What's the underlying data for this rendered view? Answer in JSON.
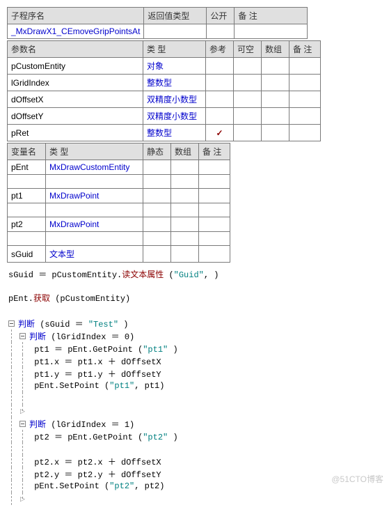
{
  "table1": {
    "headers": [
      "子程序名",
      "返回值类型",
      "公开",
      "备 注"
    ],
    "row": [
      "_MxDrawX1_CEmoveGripPointsAt",
      "",
      "",
      ""
    ]
  },
  "table2": {
    "headers": [
      "参数名",
      "类 型",
      "参考",
      "可空",
      "数组",
      "备 注"
    ],
    "rows": [
      {
        "name": "pCustomEntity",
        "type": "对象",
        "ref": "",
        "null": "",
        "arr": "",
        "note": ""
      },
      {
        "name": "lGridIndex",
        "type": "整数型",
        "ref": "",
        "null": "",
        "arr": "",
        "note": ""
      },
      {
        "name": "dOffsetX",
        "type": "双精度小数型",
        "ref": "",
        "null": "",
        "arr": "",
        "note": ""
      },
      {
        "name": "dOffsetY",
        "type": "双精度小数型",
        "ref": "",
        "null": "",
        "arr": "",
        "note": ""
      },
      {
        "name": "pRet",
        "type": "整数型",
        "ref": "✓",
        "null": "",
        "arr": "",
        "note": ""
      }
    ]
  },
  "table3": {
    "headers": [
      "变量名",
      "类 型",
      "静态",
      "数组",
      "备 注"
    ],
    "rows": [
      {
        "name": "pEnt",
        "type": "MxDrawCustomEntity",
        "s": "",
        "a": "",
        "n": ""
      },
      {
        "name": "",
        "type": "",
        "s": "",
        "a": "",
        "n": ""
      },
      {
        "name": "pt1",
        "type": "MxDrawPoint",
        "s": "",
        "a": "",
        "n": ""
      },
      {
        "name": "",
        "type": "",
        "s": "",
        "a": "",
        "n": ""
      },
      {
        "name": "pt2",
        "type": "MxDrawPoint",
        "s": "",
        "a": "",
        "n": ""
      },
      {
        "name": "",
        "type": "",
        "s": "",
        "a": "",
        "n": ""
      },
      {
        "name": "sGuid",
        "type": "文本型",
        "s": "",
        "a": "",
        "n": ""
      }
    ]
  },
  "code": {
    "line1_var": "sGuid ＝ pCustomEntity.",
    "line1_method": "读文本属性",
    "line1_args": " (",
    "line1_str": "\"Guid\"",
    "line1_end": ", )",
    "line2_pre": "pEnt.",
    "line2_method": "获取",
    "line2_end": " (pCustomEntity)",
    "t1_kw": "判断",
    "t1_cond": " (sGuid ＝ ",
    "t1_str": "\"Test\"",
    "t1_end": " )",
    "t2_kw": "判断",
    "t2_cond": " (lGridIndex ＝ 0)",
    "t3": "pt1 ＝ pEnt.GetPoint (",
    "t3_str": "\"pt1\"",
    "t3_end": " )",
    "t4": "pt1.x ＝ pt1.x ＋ dOffsetX",
    "t5": "pt1.y ＝ pt1.y ＋ dOffsetY",
    "t6_pre": "pEnt.SetPoint (",
    "t6_str": "\"pt1\"",
    "t6_end": ", pt1)",
    "t7_kw": "判断",
    "t7_cond": " (lGridIndex ＝ 1)",
    "t8": "pt2 ＝ pEnt.GetPoint (",
    "t8_str": "\"pt2\"",
    "t8_end": " )",
    "t9": "pt2.x ＝ pt2.x ＋ dOffsetX",
    "t10": "pt2.y ＝ pt2.y ＋ dOffsetY",
    "t11_pre": "pEnt.SetPoint (",
    "t11_str": "\"pt2\"",
    "t11_end": ", pt2)"
  },
  "watermark": "@51CTO博客"
}
